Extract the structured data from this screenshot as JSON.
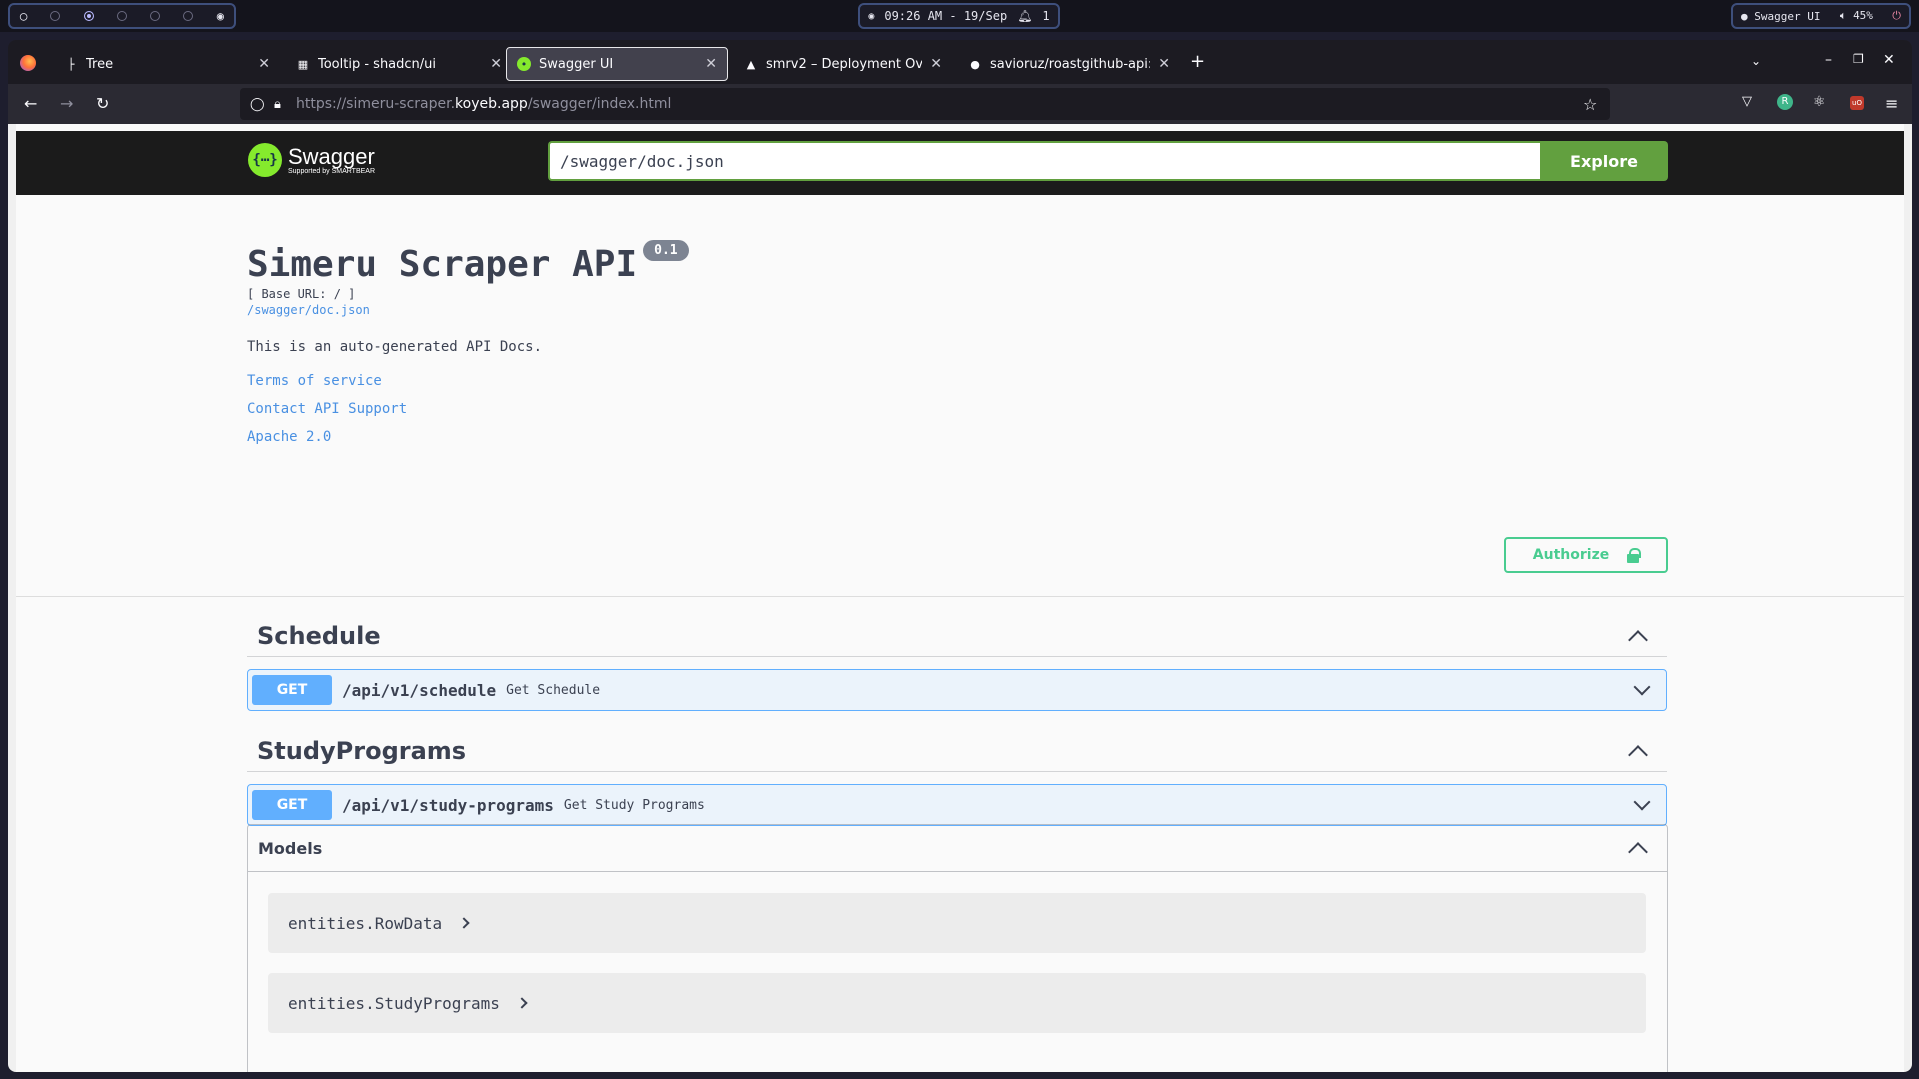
{
  "desktop": {
    "clock": "09:26 AM - 19/Sep",
    "notifications": "1",
    "active_window": "Swagger UI",
    "volume": "45%"
  },
  "browser": {
    "tabs": [
      {
        "label": "Tree",
        "icon": "tree-icon"
      },
      {
        "label": "Tooltip - shadcn/ui",
        "icon": "shadcn-icon"
      },
      {
        "label": "Swagger UI",
        "icon": "swagger-icon",
        "active": true
      },
      {
        "label": "smrv2 – Deployment Over",
        "icon": "vercel-icon"
      },
      {
        "label": "savioruz/roastgithub-api: r",
        "icon": "github-icon"
      }
    ],
    "url": {
      "prefix": "https://simeru-scraper.",
      "domain": "koyeb.app",
      "path": "/swagger/index.html"
    }
  },
  "swagger": {
    "logo_text": "Swagger",
    "logo_sub": "Supported by SMARTBEAR",
    "spec_url": "/swagger/doc.json",
    "explore_label": "Explore",
    "title": "Simeru Scraper API",
    "version": "0.1",
    "base_url": "[ Base URL: / ]",
    "doc_link": "/swagger/doc.json",
    "description": "This is an auto-generated API Docs.",
    "links": [
      "Terms of service",
      "Contact API Support",
      "Apache 2.0"
    ],
    "authorize_label": "Authorize",
    "tags": [
      {
        "name": "Schedule",
        "operations": [
          {
            "method": "GET",
            "path": "/api/v1/schedule",
            "summary": "Get Schedule"
          }
        ]
      },
      {
        "name": "StudyPrograms",
        "operations": [
          {
            "method": "GET",
            "path": "/api/v1/study-programs",
            "summary": "Get Study Programs"
          }
        ]
      }
    ],
    "models_title": "Models",
    "models": [
      "entities.RowData",
      "entities.StudyPrograms"
    ]
  },
  "colors": {
    "get_method": "#61affe",
    "explore": "#62a03f",
    "authorize": "#49cc90",
    "link": "#4990e2"
  }
}
